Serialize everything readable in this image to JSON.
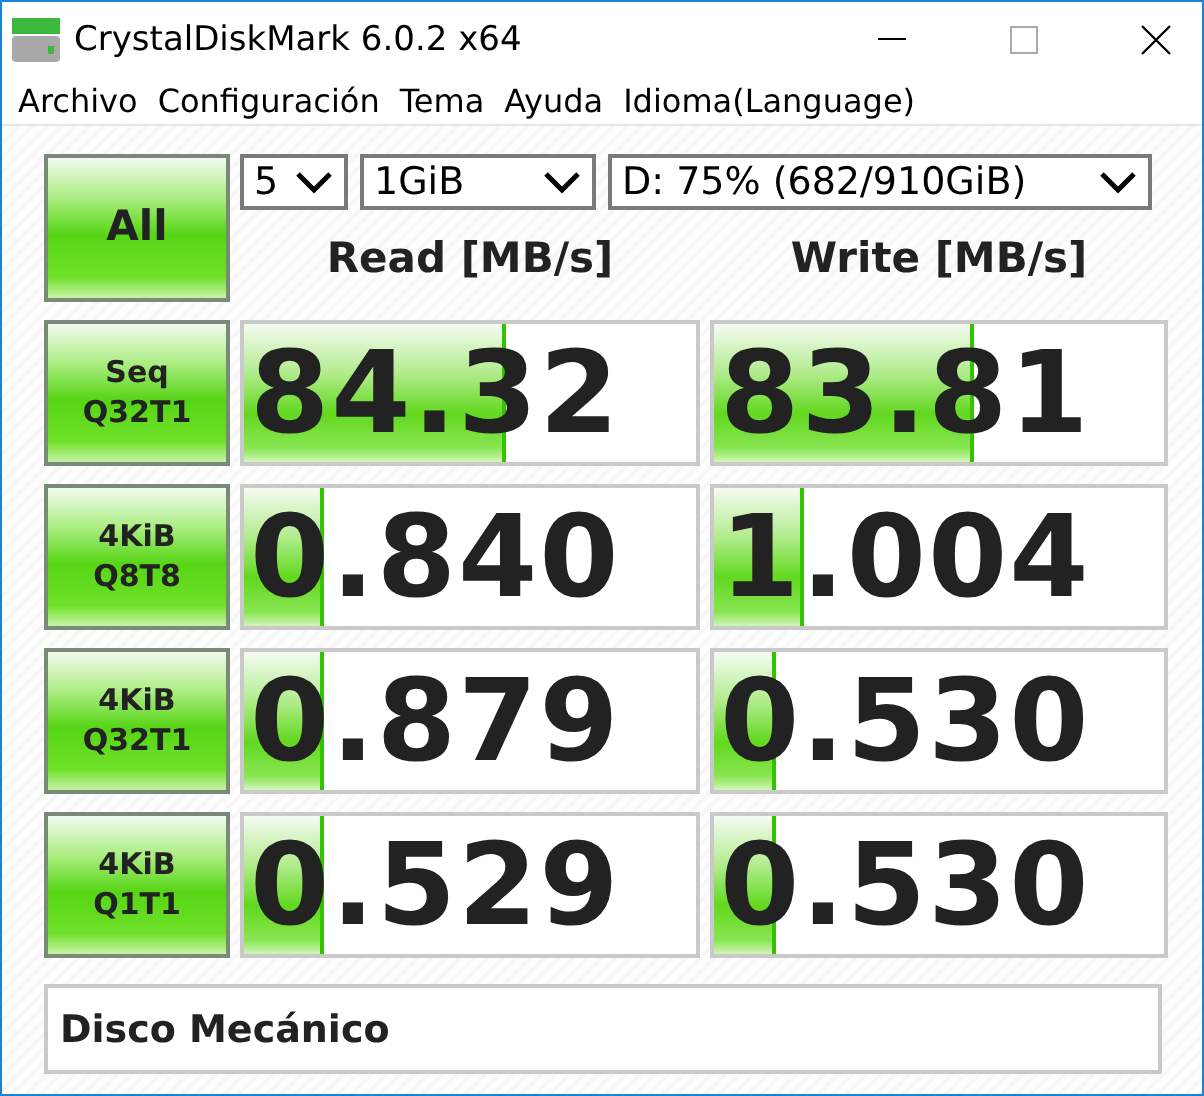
{
  "window": {
    "title": "CrystalDiskMark 6.0.2 x64"
  },
  "menu": [
    "Archivo",
    "Configuración",
    "Tema",
    "Ayuda",
    "Idioma(Language)"
  ],
  "all_button": "All",
  "selects": [
    {
      "value": "5"
    },
    {
      "value": "1GiB"
    },
    {
      "value": "D: 75% (682/910GiB)"
    }
  ],
  "columns": [
    "Read [MB/s]",
    "Write [MB/s]"
  ],
  "tests": [
    {
      "label": [
        "Seq",
        "Q32T1"
      ],
      "read": {
        "value": "84.32",
        "level": 0.57
      },
      "write": {
        "value": "83.81",
        "level": 0.57
      }
    },
    {
      "label": [
        "4KiB",
        "Q8T8"
      ],
      "read": {
        "value": "0.840",
        "level": 0.17
      },
      "write": {
        "value": "1.004",
        "level": 0.19
      }
    },
    {
      "label": [
        "4KiB",
        "Q32T1"
      ],
      "read": {
        "value": "0.879",
        "level": 0.17
      },
      "write": {
        "value": "0.530",
        "level": 0.13
      }
    },
    {
      "label": [
        "4KiB",
        "Q1T1"
      ],
      "read": {
        "value": "0.529",
        "level": 0.17
      },
      "write": {
        "value": "0.530",
        "level": 0.13
      }
    }
  ],
  "comment": "Disco Mecánico"
}
